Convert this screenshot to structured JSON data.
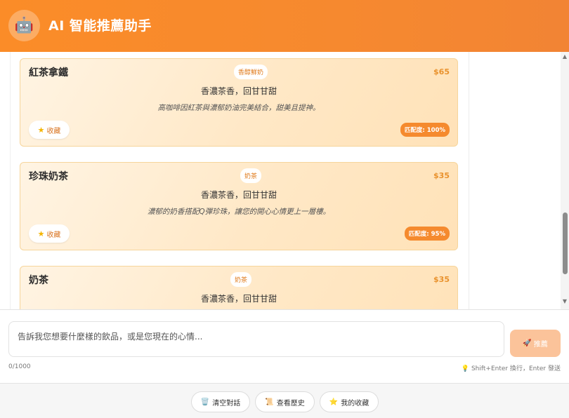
{
  "header": {
    "avatar_emoji": "🤖",
    "title": "AI 智能推薦助手"
  },
  "cards": [
    {
      "name": "紅茶拿鐵",
      "tag": "香醇鮮奶",
      "price": "$65",
      "flavor": "香濃茶香，回甘甘甜",
      "description": "高咖啡因紅茶與濃郁奶油完美結合，甜美且提神。",
      "favorite_label": "收藏",
      "match": "匹配度: 100%"
    },
    {
      "name": "珍珠奶茶",
      "tag": "奶茶",
      "price": "$35",
      "flavor": "香濃茶香，回甘甘甜",
      "description": "濃郁的奶香搭配Q彈珍珠，讓您的開心心情更上一層樓。",
      "favorite_label": "收藏",
      "match": "匹配度: 95%"
    },
    {
      "name": "奶茶",
      "tag": "奶茶",
      "price": "$35",
      "flavor": "香濃茶香，回甘甘甜",
      "description": "",
      "favorite_label": "收藏",
      "match": ""
    }
  ],
  "input": {
    "placeholder": "告訴我您想要什麼樣的飲品，或是您現在的心情...",
    "value": "",
    "send_label": "推薦",
    "send_icon": "🚀",
    "char_count": "0/1000",
    "hint_icon": "💡",
    "hint": "Shift+Enter 換行，Enter 發送"
  },
  "footer": {
    "clear_icon": "🗑️",
    "clear_label": "清空對話",
    "history_icon": "📜",
    "history_label": "查看歷史",
    "favorites_icon": "⭐",
    "favorites_label": "我的收藏"
  },
  "colors": {
    "accent": "#f58a2e",
    "card_border": "#f6d59b",
    "price": "#e9922d"
  }
}
